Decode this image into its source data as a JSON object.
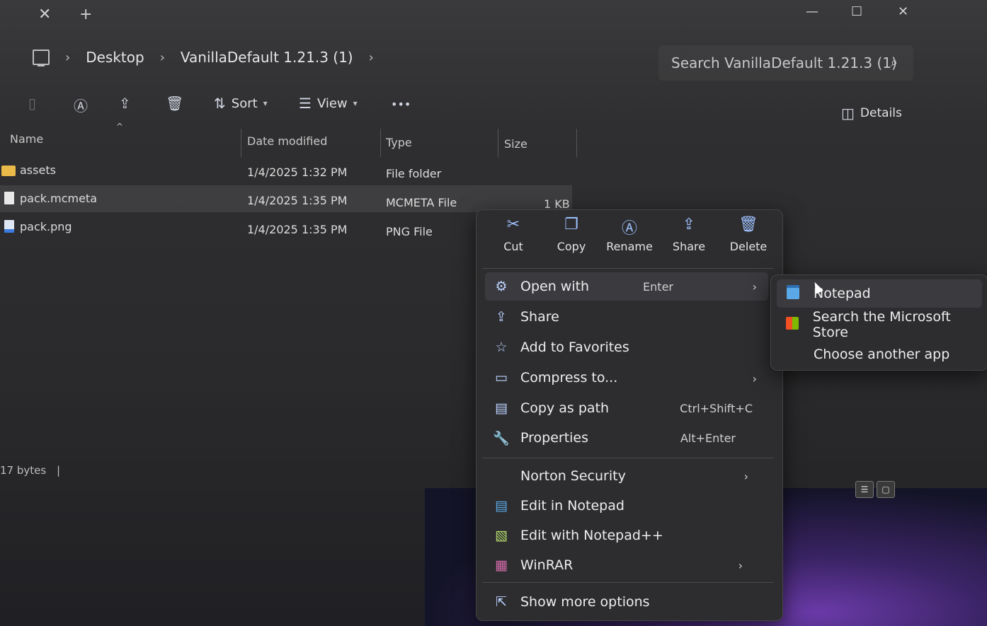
{
  "window": {
    "close_tab_glyph": "✕",
    "new_tab_glyph": "+",
    "controls": [
      "—",
      "☐",
      "✕"
    ]
  },
  "address": {
    "crumbs": [
      "Desktop",
      "VanillaDefault 1.21.3 (1)"
    ],
    "search_placeholder": "Search VanillaDefault 1.21.3 (1)"
  },
  "toolbar": {
    "sort_label": "Sort",
    "view_label": "View",
    "more_label": "•••",
    "details_label": "Details"
  },
  "columns": [
    "Name",
    "Date modified",
    "Type",
    "Size"
  ],
  "files": [
    {
      "name": "assets",
      "date": "1/4/2025 1:32 PM",
      "type": "File folder",
      "size": "",
      "icon": "folder-icon"
    },
    {
      "name": "pack.mcmeta",
      "date": "1/4/2025 1:35 PM",
      "type": "MCMETA File",
      "size": "1 KB",
      "icon": "file-icon"
    },
    {
      "name": "pack.png",
      "date": "1/4/2025 1:35 PM",
      "type": "PNG File",
      "size": "",
      "icon": "image-file-icon"
    }
  ],
  "status": {
    "text": "17 bytes"
  },
  "context_menu": {
    "quick_actions": [
      {
        "label": "Cut",
        "icon": "cut-icon",
        "glyph": "✂"
      },
      {
        "label": "Copy",
        "icon": "copy-icon",
        "glyph": "❐"
      },
      {
        "label": "Rename",
        "icon": "rename-icon",
        "glyph": "Ⓐ"
      },
      {
        "label": "Share",
        "icon": "share-icon",
        "glyph": "⇪"
      },
      {
        "label": "Delete",
        "icon": "delete-icon",
        "glyph": "🗑"
      }
    ],
    "items": [
      {
        "label": "Open with",
        "shortcut": "Enter",
        "arrow": "›",
        "icon": "open-with-icon",
        "glyph": "⚙"
      },
      {
        "label": "Share",
        "shortcut": "",
        "arrow": "",
        "icon": "share-icon",
        "glyph": "⇪"
      },
      {
        "label": "Add to Favorites",
        "shortcut": "",
        "arrow": "",
        "icon": "star-icon",
        "glyph": "☆"
      },
      {
        "label": "Compress to...",
        "shortcut": "",
        "arrow": "›",
        "icon": "compress-icon",
        "glyph": "▭"
      },
      {
        "label": "Copy as path",
        "shortcut": "Ctrl+Shift+C",
        "arrow": "",
        "icon": "copy-path-icon",
        "glyph": "▤"
      },
      {
        "label": "Properties",
        "shortcut": "Alt+Enter",
        "arrow": "",
        "icon": "wrench-icon",
        "glyph": "🔧"
      },
      {
        "label": "Norton Security",
        "shortcut": "",
        "arrow": "›",
        "icon": "",
        "glyph": ""
      },
      {
        "label": "Edit in Notepad",
        "shortcut": "",
        "arrow": "",
        "icon": "notepad-icon",
        "glyph": "▤"
      },
      {
        "label": "Edit with Notepad++",
        "shortcut": "",
        "arrow": "",
        "icon": "notepadpp-icon",
        "glyph": "▧"
      },
      {
        "label": "WinRAR",
        "shortcut": "",
        "arrow": "›",
        "icon": "winrar-icon",
        "glyph": "▦"
      },
      {
        "label": "Show more options",
        "shortcut": "",
        "arrow": "",
        "icon": "more-options-icon",
        "glyph": "⇱"
      }
    ]
  },
  "open_with_submenu": [
    {
      "label": "Notepad",
      "icon": "notepad-icon"
    },
    {
      "label": "Search the Microsoft Store",
      "icon": "store-icon"
    },
    {
      "label": "Choose another app",
      "icon": ""
    }
  ]
}
